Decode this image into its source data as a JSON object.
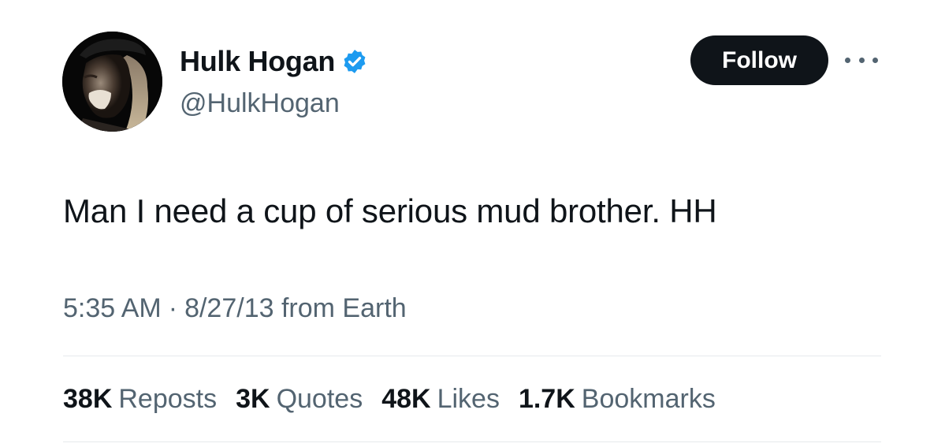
{
  "author": {
    "display_name": "Hulk Hogan",
    "handle": "@HulkHogan",
    "verified_icon": "verified-badge-icon",
    "badge_color": "#1d9bf0"
  },
  "header": {
    "follow_label": "Follow",
    "more_icon": "more-options-icon"
  },
  "tweet": {
    "text": "Man I need a cup of serious mud brother. HH",
    "time": "5:35 AM",
    "separator": "·",
    "date_source": "8/27/13 from Earth"
  },
  "stats": [
    {
      "count": "38K",
      "label": "Reposts"
    },
    {
      "count": "3K",
      "label": "Quotes"
    },
    {
      "count": "48K",
      "label": "Likes"
    },
    {
      "count": "1.7K",
      "label": "Bookmarks"
    }
  ]
}
